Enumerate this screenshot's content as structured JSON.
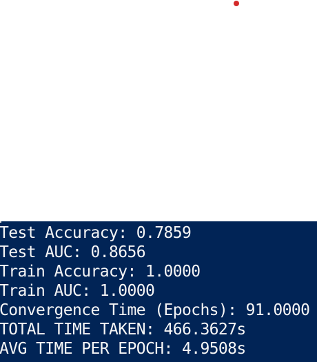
{
  "terminal": {
    "lines": [
      "Test Accuracy: 0.7859",
      "Test AUC: 0.8656",
      "Train Accuracy: 1.0000",
      "Train AUC: 1.0000",
      "Convergence Time (Epochs): 91.0000",
      "TOTAL TIME TAKEN: 466.3627s",
      "AVG TIME PER EPOCH: 4.9508s"
    ]
  },
  "colors": {
    "terminal_background": "#012456",
    "terminal_text": "#f5f5f5",
    "page_background": "#ffffff",
    "dot": "#d42a2a"
  }
}
